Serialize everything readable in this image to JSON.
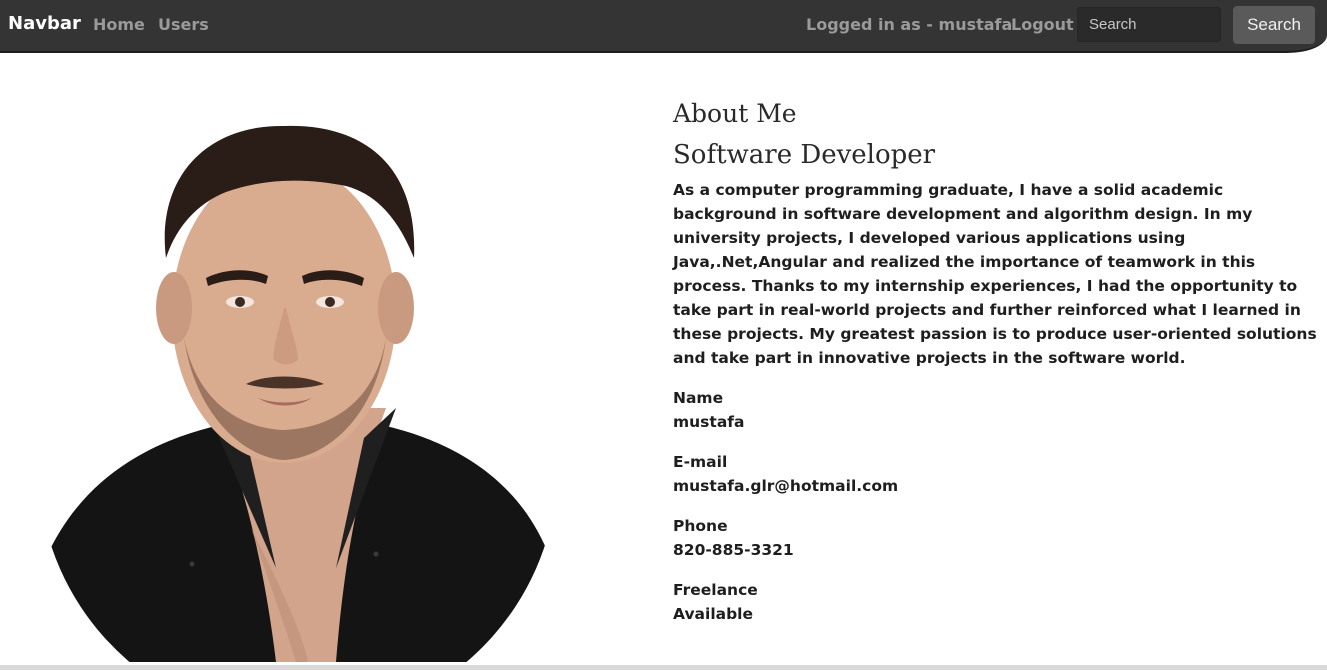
{
  "navbar": {
    "brand": "Navbar",
    "home": "Home",
    "users": "Users",
    "logged_in": "Logged in as - mustafa",
    "logout": "Logout",
    "search_placeholder": "Search",
    "search_button": "Search"
  },
  "profile": {
    "photo_icon": "profile-photo",
    "title": "About Me",
    "subtitle": "Software Developer",
    "description": "As a computer programming graduate, I have a solid academic background in software development and algorithm design. In my university projects, I developed various applications using Java,.Net,Angular and realized the importance of teamwork in this process. Thanks to my internship experiences, I had the opportunity to take part in real-world projects and further reinforced what I learned in these projects. My greatest passion is to produce user-oriented solutions and take part in innovative projects in the software world.",
    "info": [
      {
        "label": "Name",
        "value": "mustafa"
      },
      {
        "label": "E-mail",
        "value": "mustafa.glr@hotmail.com"
      },
      {
        "label": "Phone",
        "value": "820-885-3321"
      },
      {
        "label": "Freelance",
        "value": "Available"
      }
    ]
  },
  "colors": {
    "navbar_bg": "#343434",
    "nav_link": "#9a9a9a",
    "brand": "#ffffff"
  }
}
